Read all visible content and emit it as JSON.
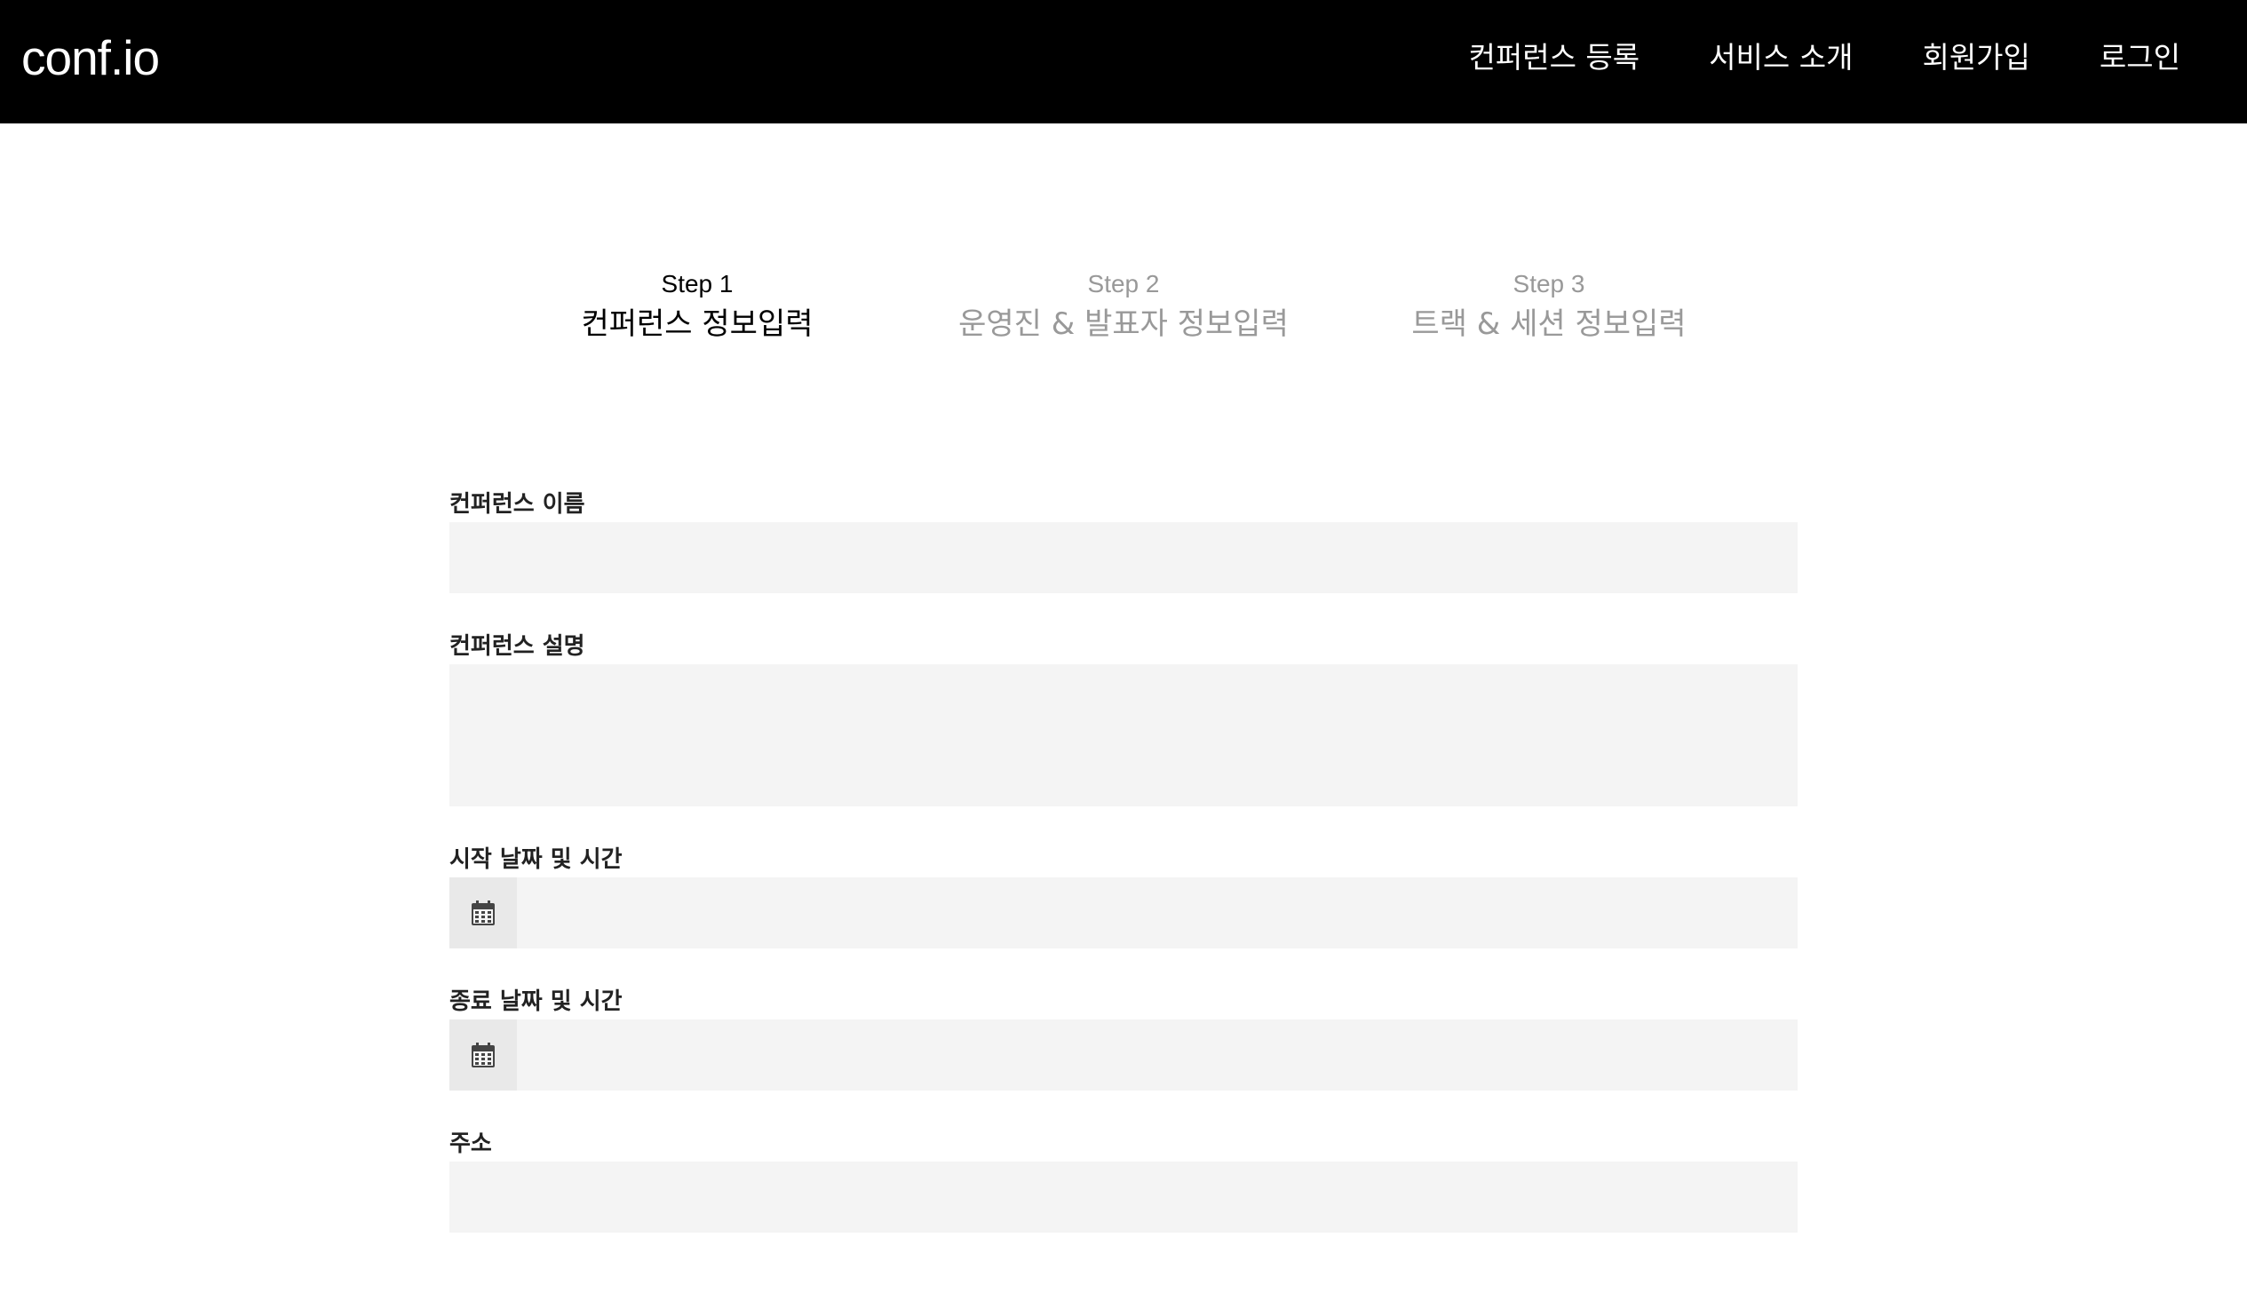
{
  "app": {
    "logo": "conf.io"
  },
  "nav": {
    "items": [
      {
        "label": "컨퍼런스 등록"
      },
      {
        "label": "서비스 소개"
      },
      {
        "label": "회원가입"
      },
      {
        "label": "로그인"
      }
    ]
  },
  "steps": [
    {
      "number": "Step 1",
      "title": "컨퍼런스 정보입력",
      "state": "active"
    },
    {
      "number": "Step 2",
      "title": "운영진 & 발표자 정보입력",
      "state": "inactive"
    },
    {
      "number": "Step 3",
      "title": "트랙 & 세션 정보입력",
      "state": "inactive"
    }
  ],
  "form": {
    "name": {
      "label": "컨퍼런스 이름",
      "value": ""
    },
    "description": {
      "label": "컨퍼런스 설명",
      "value": ""
    },
    "start": {
      "label": "시작 날짜 및 시간",
      "value": "",
      "icon": "calendar-icon"
    },
    "end": {
      "label": "종료 날짜 및 시간",
      "value": "",
      "icon": "calendar-icon"
    },
    "address": {
      "label": "주소",
      "value": ""
    }
  },
  "colors": {
    "header_bg": "#000000",
    "header_text": "#ffffff",
    "step_active": "#000000",
    "step_inactive": "#999999",
    "input_bg": "#f4f4f4",
    "icon_bg": "#e9e9e9"
  }
}
